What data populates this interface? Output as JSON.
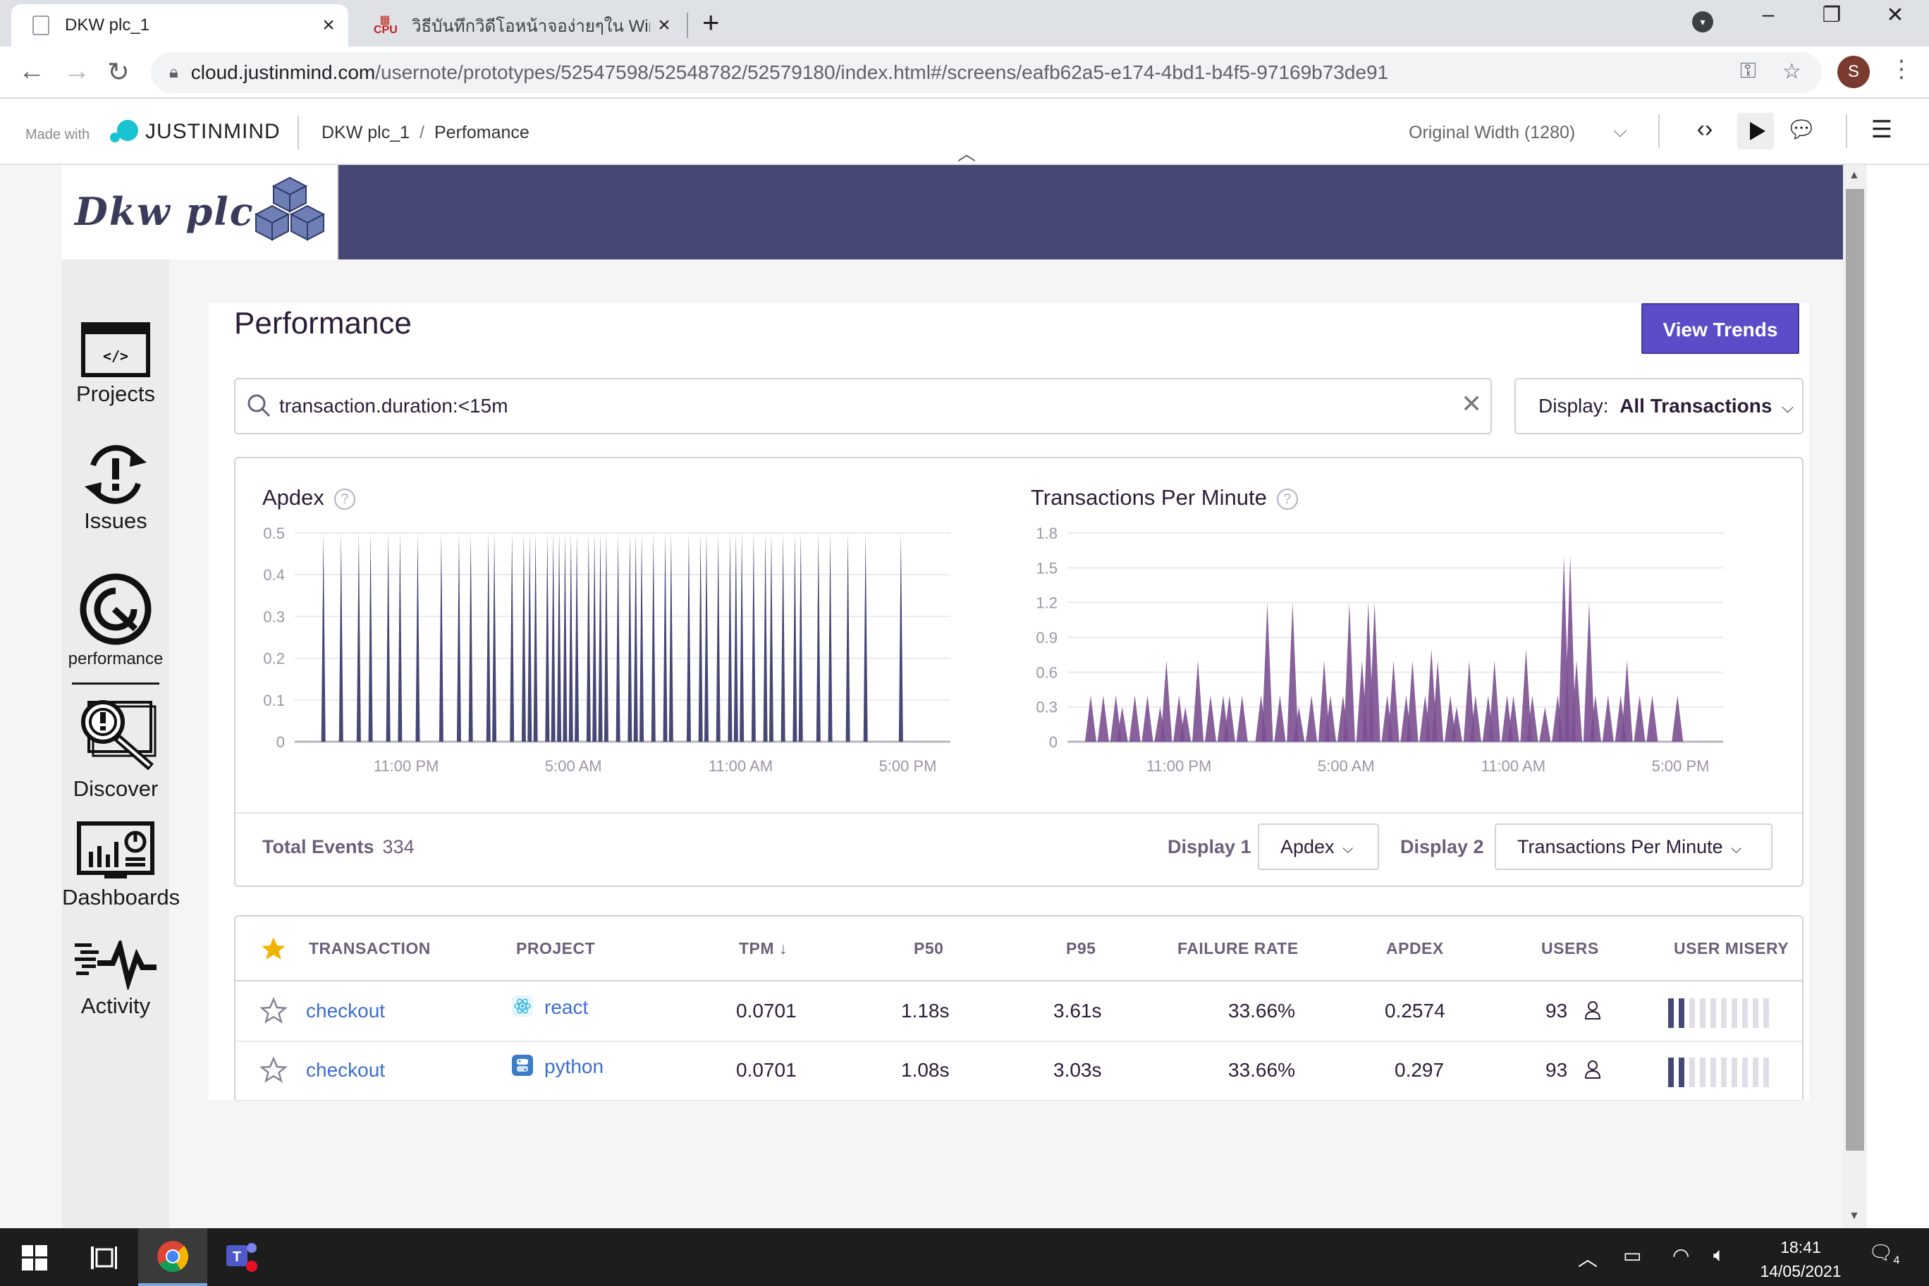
{
  "browser": {
    "tabs": [
      {
        "title": "DKW plc_1",
        "active": true
      },
      {
        "title": "วิธีบันทึกวิดีโอหน้าจอง่ายๆใน Windows",
        "active": false
      }
    ],
    "url_host": "cloud.justinmind.com",
    "url_path": "/usernote/prototypes/52547598/52548782/52579180/index.html#/screens/eafb62a5-e174-4bd1-b4f5-97169b73de91",
    "profile_initial": "S"
  },
  "justinmind": {
    "made_with": "Made with",
    "brand": "JUSTINMIND",
    "breadcrumb_project": "DKW plc_1",
    "breadcrumb_sep": "/",
    "breadcrumb_page": "Perfomance",
    "width_select": "Original Width (1280)"
  },
  "app": {
    "logo_text": "Dkw plc",
    "nav": [
      {
        "label": "Projects",
        "icon": "folder-code-icon"
      },
      {
        "label": "Issues",
        "icon": "issues-refresh-icon"
      },
      {
        "label": "performance",
        "icon": "performance-gauge-icon",
        "active": true
      },
      {
        "label": "Discover",
        "icon": "discover-magnifier-icon"
      },
      {
        "label": "Dashboards",
        "icon": "dashboard-monitor-icon"
      },
      {
        "label": "Activity",
        "icon": "activity-pulse-icon"
      }
    ],
    "page_title": "Performance",
    "view_trends": "View Trends",
    "search_value": "transaction.duration:<15m",
    "display_label": "Display:",
    "display_value": "All Transactions",
    "accent_color": "#5a4dc7",
    "brand_color": "#464775",
    "charts": {
      "total_events_label": "Total Events",
      "total_events_value": "334",
      "display1_label": "Display 1",
      "display1_value": "Apdex",
      "display2_label": "Display 2",
      "display2_value": "Transactions Per Minute"
    },
    "table": {
      "headers": [
        "TRANSACTION",
        "PROJECT",
        "TPM",
        "P50",
        "P95",
        "FAILURE RATE",
        "APDEX",
        "USERS",
        "USER MISERY"
      ],
      "rows": [
        {
          "transaction": "checkout",
          "project": "react",
          "tpm": "0.0701",
          "p50": "1.18s",
          "p95": "3.61s",
          "failure_rate": "33.66%",
          "apdex": "0.2574",
          "users": "93",
          "misery_level": 0.2
        },
        {
          "transaction": "checkout",
          "project": "python",
          "tpm": "0.0701",
          "p50": "1.08s",
          "p95": "3.03s",
          "failure_rate": "33.66%",
          "apdex": "0.297",
          "users": "93",
          "misery_level": 0.2
        }
      ]
    }
  },
  "chart_data": [
    {
      "type": "bar",
      "title": "Apdex",
      "color": "#464775",
      "ylim": [
        0,
        0.5
      ],
      "yticks": [
        "0.5",
        "0.4",
        "0.3",
        "0.2",
        "0.1",
        "0"
      ],
      "xticks": [
        "11:00 PM",
        "5:00 AM",
        "11:00 AM",
        "5:00 PM"
      ],
      "values": [
        0,
        0,
        0.5,
        0,
        0,
        0.5,
        0,
        0,
        0.5,
        0,
        0.5,
        0,
        0,
        0.5,
        0,
        0.5,
        0,
        0,
        0.5,
        0,
        0,
        0,
        0.5,
        0,
        0,
        0.5,
        0,
        0.5,
        0,
        0,
        0.5,
        0.5,
        0,
        0,
        0.5,
        0,
        0.5,
        0.5,
        0.5,
        0,
        0.5,
        0.5,
        0.5,
        0.5,
        0.5,
        0.5,
        0,
        0.5,
        0.5,
        0.5,
        0.5,
        0,
        0.5,
        0,
        0.5,
        0.5,
        0.5,
        0,
        0.5,
        0,
        0.5,
        0.5,
        0,
        0,
        0.5,
        0,
        0.5,
        0.5,
        0,
        0.5,
        0,
        0.5,
        0.5,
        0.5,
        0,
        0.5,
        0,
        0.5,
        0.5,
        0,
        0.5,
        0,
        0.5,
        0.5,
        0,
        0,
        0.5,
        0,
        0.5,
        0,
        0,
        0.5,
        0,
        0,
        0.5,
        0,
        0,
        0,
        0,
        0,
        0.5,
        0,
        0,
        0,
        0,
        0,
        0
      ]
    },
    {
      "type": "area",
      "title": "Transactions Per Minute",
      "color": "#7b4f91",
      "ylim": [
        0,
        1.8
      ],
      "yticks": [
        "1.8",
        "1.5",
        "1.2",
        "0.9",
        "0.6",
        "0.3",
        "0"
      ],
      "xticks": [
        "11:00 PM",
        "5:00 AM",
        "11:00 AM",
        "5:00 PM"
      ],
      "values": [
        0,
        0.4,
        0,
        0.4,
        0,
        0.4,
        0.3,
        0,
        0.4,
        0,
        0.4,
        0,
        0.3,
        0.7,
        0,
        0.4,
        0.3,
        0,
        0.7,
        0,
        0.4,
        0,
        0.4,
        0.4,
        0,
        0.4,
        0,
        0,
        0.4,
        1.2,
        0,
        0.4,
        0,
        1.2,
        0.3,
        0,
        0.4,
        0,
        0.7,
        0.4,
        0,
        0.4,
        1.2,
        0,
        0.7,
        1.2,
        1.2,
        0,
        0.4,
        0.7,
        0,
        0.4,
        0.7,
        0,
        0.4,
        0.8,
        0.7,
        0,
        0.4,
        0.3,
        0,
        0.7,
        0.4,
        0,
        0.4,
        0.7,
        0,
        0.4,
        0.4,
        0,
        0.8,
        0.4,
        0,
        0.3,
        0,
        0.4,
        1.6,
        1.6,
        0.7,
        0,
        1.2,
        0.4,
        0,
        0.4,
        0,
        0.4,
        0.7,
        0,
        0.4,
        0,
        0.4,
        0,
        0,
        0,
        0.4,
        0,
        0,
        0,
        0,
        0
      ]
    }
  ],
  "taskbar": {
    "time": "18:41",
    "date": "14/05/2021",
    "notifications": "4"
  }
}
